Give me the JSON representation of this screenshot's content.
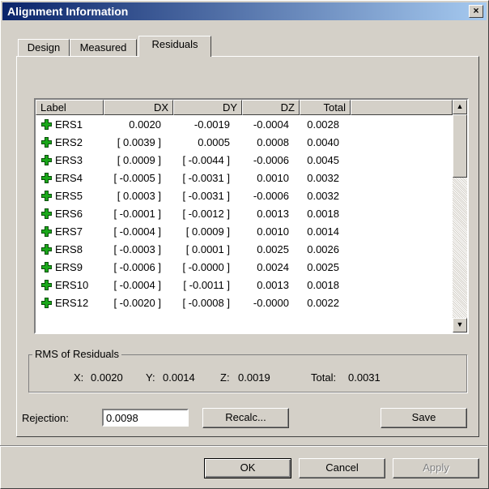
{
  "window": {
    "title": "Alignment Information",
    "close_label": "×"
  },
  "tabs": [
    {
      "label": "Design"
    },
    {
      "label": "Measured"
    },
    {
      "label": "Residuals"
    }
  ],
  "columns": [
    "Label",
    "DX",
    "DY",
    "DZ",
    "Total",
    ""
  ],
  "rows": [
    {
      "label": "ERS1",
      "dx": "0.0020",
      "dy": "-0.0019",
      "dz": "-0.0004",
      "total": "0.0028"
    },
    {
      "label": "ERS2",
      "dx": "[ 0.0039 ]",
      "dy": "0.0005",
      "dz": "0.0008",
      "total": "0.0040"
    },
    {
      "label": "ERS3",
      "dx": "[ 0.0009 ]",
      "dy": "[ -0.0044 ]",
      "dz": "-0.0006",
      "total": "0.0045"
    },
    {
      "label": "ERS4",
      "dx": "[ -0.0005 ]",
      "dy": "[ -0.0031 ]",
      "dz": "0.0010",
      "total": "0.0032"
    },
    {
      "label": "ERS5",
      "dx": "[ 0.0003 ]",
      "dy": "[ -0.0031 ]",
      "dz": "-0.0006",
      "total": "0.0032"
    },
    {
      "label": "ERS6",
      "dx": "[ -0.0001 ]",
      "dy": "[ -0.0012 ]",
      "dz": "0.0013",
      "total": "0.0018"
    },
    {
      "label": "ERS7",
      "dx": "[ -0.0004 ]",
      "dy": "[ 0.0009 ]",
      "dz": "0.0010",
      "total": "0.0014"
    },
    {
      "label": "ERS8",
      "dx": "[ -0.0003 ]",
      "dy": "[ 0.0001 ]",
      "dz": "0.0025",
      "total": "0.0026"
    },
    {
      "label": "ERS9",
      "dx": "[ -0.0006 ]",
      "dy": "[ -0.0000 ]",
      "dz": "0.0024",
      "total": "0.0025"
    },
    {
      "label": "ERS10",
      "dx": "[ -0.0004 ]",
      "dy": "[ -0.0011 ]",
      "dz": "0.0013",
      "total": "0.0018"
    },
    {
      "label": "ERS12",
      "dx": "[ -0.0020 ]",
      "dy": "[ -0.0008 ]",
      "dz": "-0.0000",
      "total": "0.0022"
    }
  ],
  "row_icon": "green-plus-icon",
  "rms": {
    "title": "RMS of Residuals",
    "x_label": "X:",
    "x": "0.0020",
    "y_label": "Y:",
    "y": "0.0014",
    "z_label": "Z:",
    "z": "0.0019",
    "total_label": "Total:",
    "total": "0.0031"
  },
  "rejection": {
    "label": "Rejection:",
    "value": "0.0098"
  },
  "buttons": {
    "recalc": "Recalc...",
    "save": "Save",
    "ok": "OK",
    "cancel": "Cancel",
    "apply": "Apply"
  },
  "colors": {
    "titlebar_start": "#0a246a",
    "titlebar_end": "#a6caf0",
    "face": "#d4d0c8",
    "icon_green": "#1aa81a"
  }
}
